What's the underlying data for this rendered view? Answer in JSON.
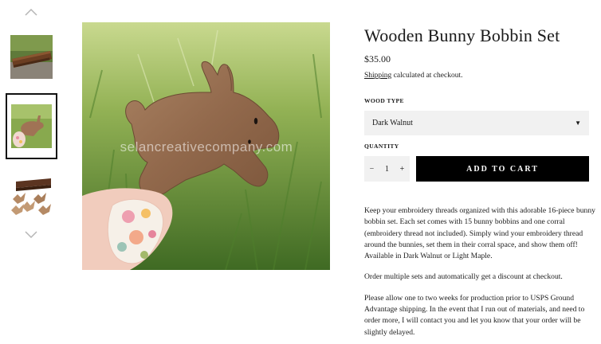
{
  "product": {
    "title": "Wooden Bunny Bobbin Set",
    "price": "$35.00",
    "shipping_link": "Shipping",
    "shipping_rest": " calculated at checkout."
  },
  "wood_type": {
    "label": "WOOD TYPE",
    "selected": "Dark Walnut"
  },
  "quantity": {
    "label": "QUANTITY",
    "minus": "−",
    "value": "1",
    "plus": "+"
  },
  "add_to_cart": "ADD TO CART",
  "main_image": {
    "watermark": "selancreativecompany.com"
  },
  "description": [
    "Keep your embroidery threads organized with this adorable 16-piece bunny bobbin set. Each set comes with 15 bunny bobbins and one corral (embroidery thread not included). Simply wind your embroidery thread around the bunnies, set them in their corral space, and show them off! Available in Dark Walnut or Light Maple.",
    "Order multiple sets and automatically get a discount at checkout.",
    "Please allow one to two weeks for production prior to USPS Ground Advantage shipping. In the event that I run out of materials, and need to order more, I will contact you and let you know that your order will be slightly delayed."
  ],
  "icons": {
    "up": "chevron-up-icon",
    "down": "chevron-down-icon",
    "caret": "caret-down-icon"
  },
  "colors": {
    "button_bg": "#000000",
    "field_bg": "#f1f1f1",
    "text": "#1a1a1a"
  }
}
